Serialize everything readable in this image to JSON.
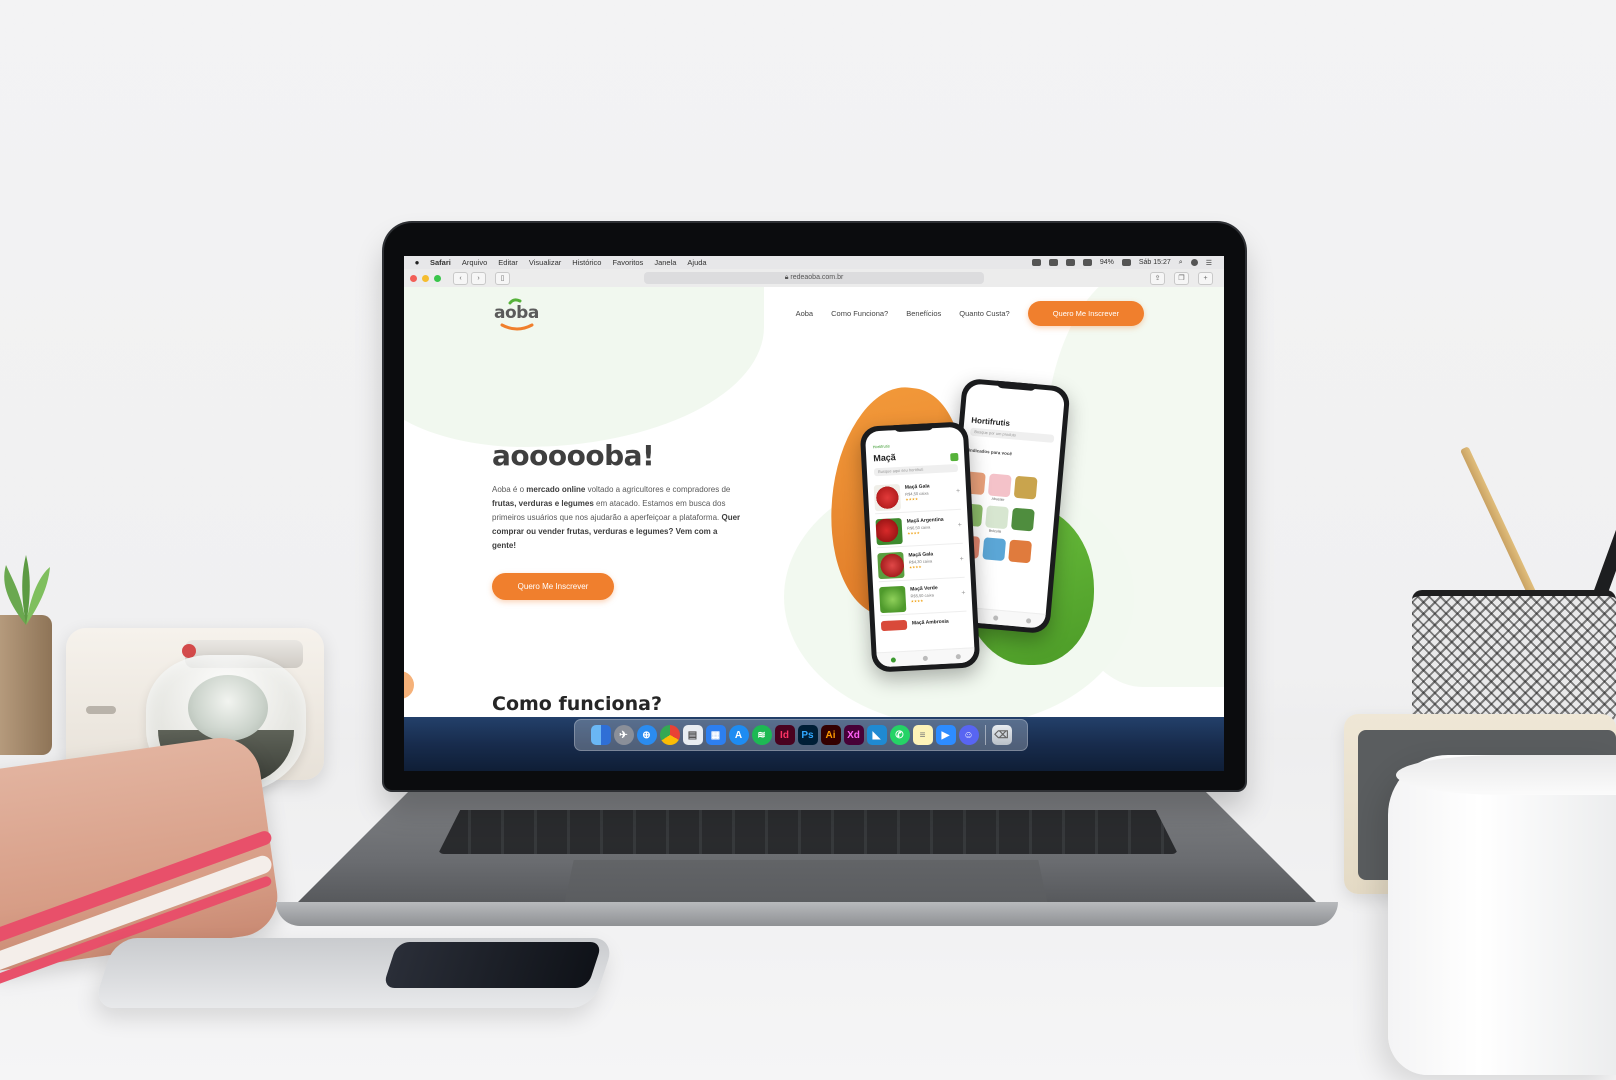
{
  "macos_menubar": {
    "app": "Safari",
    "items": [
      "Arquivo",
      "Editar",
      "Visualizar",
      "Histórico",
      "Favoritos",
      "Janela",
      "Ajuda"
    ],
    "battery": "94%",
    "clock": "Sáb 15:27"
  },
  "browser": {
    "url": "redeaoba.com.br"
  },
  "site": {
    "logo": "aoba",
    "nav": [
      "Aoba",
      "Como Funciona?",
      "Benefícios",
      "Quanto Custa?"
    ],
    "nav_cta": "Quero Me Inscrever",
    "hero": {
      "title": "aoooooba!",
      "text_1": "Aoba é o ",
      "text_b1": "mercado online",
      "text_2": " voltado a agricultores e compradores de ",
      "text_b2": "frutas, verduras e legumes",
      "text_3": " em atacado. Estamos em busca dos primeiros usuários que nos ajudarão a aperfeiçoar a plataforma. ",
      "text_b3": "Quer comprar ou vender frutas, verduras e legumes? Vem com a gente!",
      "cta": "Quero Me Inscrever"
    },
    "section_title": "Como funciona?"
  },
  "phone_back": {
    "title": "Hortifrutis",
    "search": "Busque por um produto",
    "subtitle": "Indicados para você",
    "grid_labels": [
      "Abacate",
      "Brócolis"
    ]
  },
  "phone_front": {
    "back": "Hortifrutis",
    "title": "Maçã",
    "search": "Busque aqui seu hortifruti",
    "products": [
      {
        "name": "Maçã Gala",
        "price": "R$4,50 caixa",
        "stars": "★★★★"
      },
      {
        "name": "Maçã Argentina",
        "price": "R$6,50 caixa",
        "stars": "★★★★"
      },
      {
        "name": "Maçã Gala",
        "price": "R$4,30 caixa",
        "stars": "★★★★"
      },
      {
        "name": "Maçã Verde",
        "price": "R$5,50 caixa",
        "stars": "★★★★"
      },
      {
        "name": "Maçã Ambrosia",
        "price": "",
        "stars": ""
      }
    ]
  },
  "dock_apps": [
    "finder-icon",
    "launchpad-icon",
    "safari-icon",
    "chrome-icon",
    "preview-icon",
    "keynote-icon",
    "app-store-icon",
    "spotify-icon",
    "indesign-icon",
    "photoshop-icon",
    "illustrator-icon",
    "xd-icon",
    "vscode-icon",
    "whatsapp-icon",
    "notes-icon",
    "zoom-icon",
    "discord-icon",
    "trash-icon"
  ],
  "dock_labels": {
    "indesign": "Id",
    "photoshop": "Ps",
    "illustrator": "Ai",
    "xd": "Xd"
  },
  "colors": {
    "brand_orange": "#f07f2d",
    "brand_green": "#56b23a",
    "title_text": "#3f3f3f"
  }
}
